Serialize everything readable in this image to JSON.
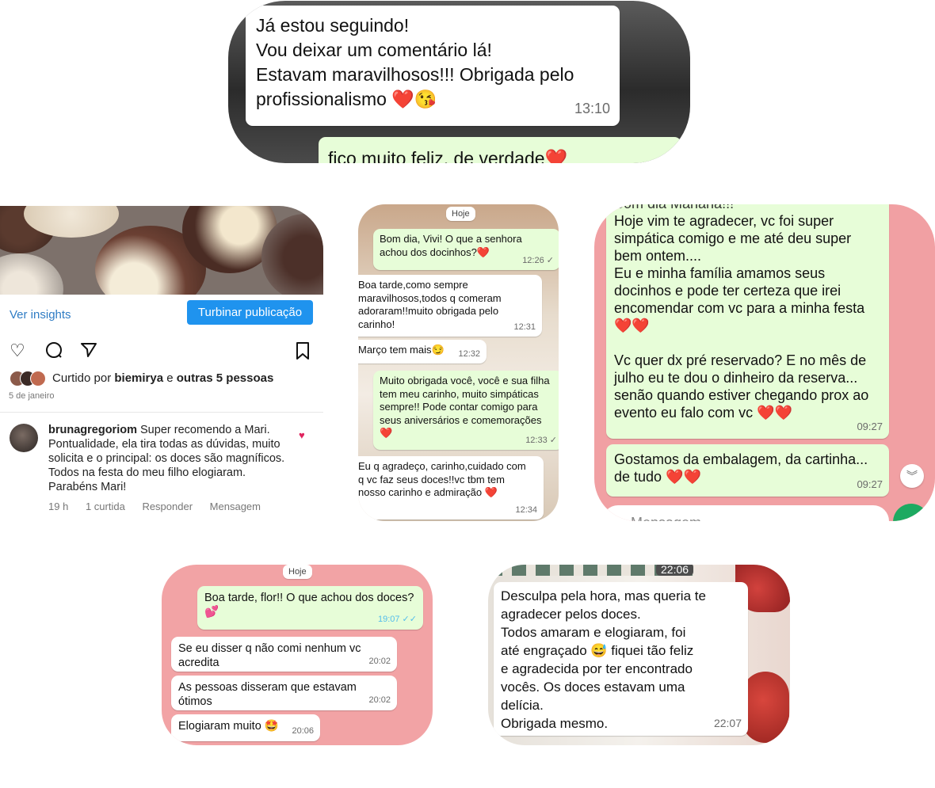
{
  "card1": {
    "incoming": {
      "lines": [
        "Já estou seguindo!",
        "Vou deixar um comentário lá!",
        "Estavam maravilhosos!!! Obrigada pelo",
        "profissionalismo ❤️😘"
      ],
      "time": "13:10"
    },
    "outgoing_partial": "fico muito feliz, de verdade❤️"
  },
  "instagram": {
    "insights_link": "Ver insights",
    "boost_button": "Turbinar publicação",
    "likes": {
      "prefix": "Curtido por ",
      "user": "biemirya",
      "middle": " e ",
      "others": "outras 5 pessoas"
    },
    "date": "5 de janeiro",
    "comment": {
      "username": "brunagregoriom",
      "text": " Super recomendo a Mari. Pontualidade, ela tira todas as dúvidas, muito solicita e o principal: os doces são magníficos. Todos na festa do meu filho elogiaram. Parabéns Mari!",
      "age": "19 h",
      "likes": "1 curtida",
      "reply": "Responder",
      "message": "Mensagem"
    }
  },
  "card3": {
    "date_chip": "Hoje",
    "messages": [
      {
        "lines": [
          "Bom dia, Vivi! O que a senhora",
          "achou dos docinhos?❤️"
        ],
        "time": "12:26 ✓"
      },
      {
        "lines": [
          "Boa tarde,como sempre",
          "maravilhosos,todos q comeram",
          "adoraram!!muito obrigada pelo",
          "carinho!"
        ],
        "time": "12:31"
      },
      {
        "lines": [
          "Março tem mais😏"
        ],
        "time": "12:32"
      },
      {
        "lines": [
          "Muito obrigada você, você e sua filha",
          "tem meu carinho, muito simpáticas",
          "sempre!! Pode contar comigo para",
          "seus aniversários e comemorações",
          "❤️"
        ],
        "time": "12:33 ✓"
      },
      {
        "lines": [
          "Eu q agradeço, carinho,cuidado com",
          "q vc faz seus doces!!vc tbm tem",
          "nosso  carinho e admiração ❤️"
        ],
        "time": "12:34"
      }
    ]
  },
  "card4": {
    "partial_top": "Bom dia Mariana!!!",
    "messages": [
      {
        "lines": [
          "Hoje vim te agradecer, vc foi super",
          "simpática comigo e me até deu super",
          "bem ontem....",
          "Eu e minha família amamos seus",
          "docinhos e pode ter certeza que irei",
          "encomendar com vc para a minha festa",
          "❤️❤️",
          "",
          "Vc quer dx pré reservado? E no mês de",
          "julho eu te dou o dinheiro da reserva...",
          "senão quando estiver chegando prox ao",
          "evento eu falo com vc ❤️❤️"
        ],
        "time": "09:27"
      },
      {
        "lines": [
          "Gostamos da embalagem, da cartinha...",
          "de tudo ❤️❤️"
        ],
        "time": "09:27"
      }
    ],
    "input_placeholder": "Mensagem"
  },
  "card5": {
    "date_chip": "Hoje",
    "messages": [
      {
        "dir": "out",
        "lines": [
          "Boa tarde, flor!! O que achou dos doces?",
          "💕"
        ],
        "time": "19:07 ✓✓"
      },
      {
        "dir": "in",
        "lines": [
          "Se eu disser q não comi nenhum vc",
          "acredita"
        ],
        "time": "20:02"
      },
      {
        "dir": "in",
        "lines": [
          "As pessoas disseram que estavam",
          "ótimos"
        ],
        "time": "20:02"
      },
      {
        "dir": "in",
        "lines": [
          "Elogiaram muito 🤩"
        ],
        "time": "20:06"
      }
    ]
  },
  "card6": {
    "top_time": "22:06",
    "message": {
      "lines": [
        "Desculpa pela hora, mas queria te",
        "agradecer pelos doces.",
        "Todos amaram e elogiaram, foi",
        "até engraçado 😅 fiquei tão feliz",
        "e agradecida por ter encontrado",
        "vocês. Os doces estavam uma",
        "delícia.",
        "Obrigada mesmo."
      ],
      "time": "22:07"
    }
  }
}
